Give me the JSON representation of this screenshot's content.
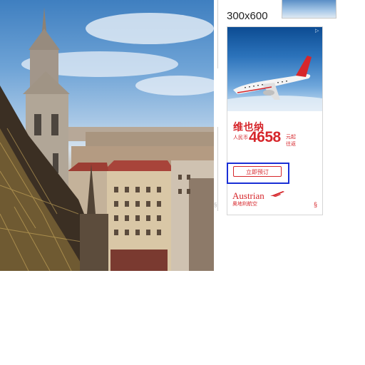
{
  "ad": {
    "size_label": "300x600",
    "destination": "维也纳",
    "currency_label": "人民币",
    "price": "4658",
    "price_suffix": "元起",
    "price_suffix2": "往返",
    "cta_label": "立即预订",
    "brand_name": "Austrian",
    "brand_subtitle": "奥地利航空",
    "legal_mark": "§",
    "side_mark": "§",
    "accent_color": "#d6262b"
  },
  "icons": {
    "adchoice": "adchoice-icon",
    "brand": "austrian-arrow-logo-icon"
  },
  "selection": {
    "highlight_color": "#1a2fd6"
  }
}
